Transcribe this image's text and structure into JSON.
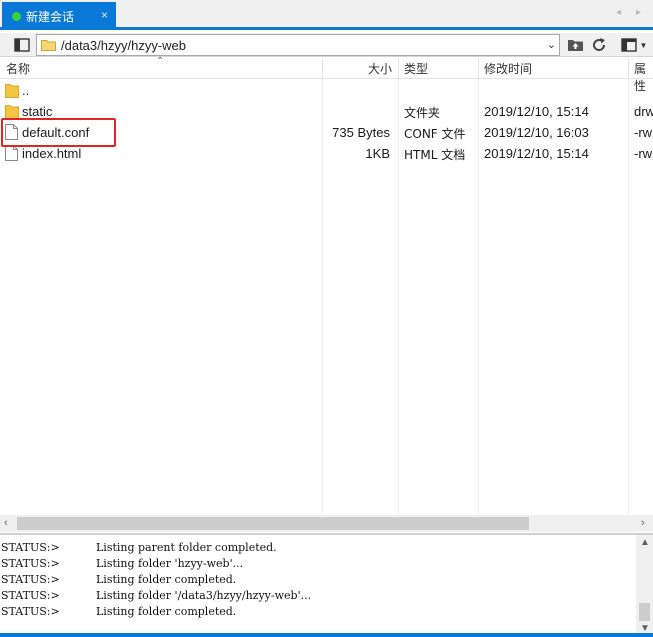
{
  "tab": {
    "label": "新建会话",
    "close": "×"
  },
  "tab_nav": {
    "prev": "◂",
    "next": "▸"
  },
  "toolbar": {
    "path": "/data3/hzyy/hzyy-web"
  },
  "columns": {
    "name": "名称",
    "size": "大小",
    "type": "类型",
    "modified": "修改时间",
    "attr": "属性"
  },
  "rows": [
    {
      "name": "..",
      "size": "",
      "type": "",
      "modified": "",
      "attr": "",
      "kind": "folder"
    },
    {
      "name": "static",
      "size": "",
      "type": "文件夹",
      "modified": "2019/12/10, 15:14",
      "attr": "drw",
      "kind": "folder"
    },
    {
      "name": "default.conf",
      "size": "735 Bytes",
      "type": "CONF 文件",
      "modified": "2019/12/10, 16:03",
      "attr": "-rw",
      "kind": "file"
    },
    {
      "name": "index.html",
      "size": "1KB",
      "type": "HTML 文档",
      "modified": "2019/12/10, 15:14",
      "attr": "-rw",
      "kind": "file"
    }
  ],
  "log": [
    {
      "status": "STATUS:>",
      "message": "Listing parent folder completed."
    },
    {
      "status": "STATUS:>",
      "message": "Listing folder 'hzyy-web'..."
    },
    {
      "status": "STATUS:>",
      "message": "Listing folder completed."
    },
    {
      "status": "STATUS:>",
      "message": "Listing folder '/data3/hzyy/hzyy-web'..."
    },
    {
      "status": "STATUS:>",
      "message": "Listing folder completed."
    }
  ],
  "colors": {
    "accent": "#0a78d7",
    "highlight": "#e32424",
    "folder": "#f5c542"
  }
}
